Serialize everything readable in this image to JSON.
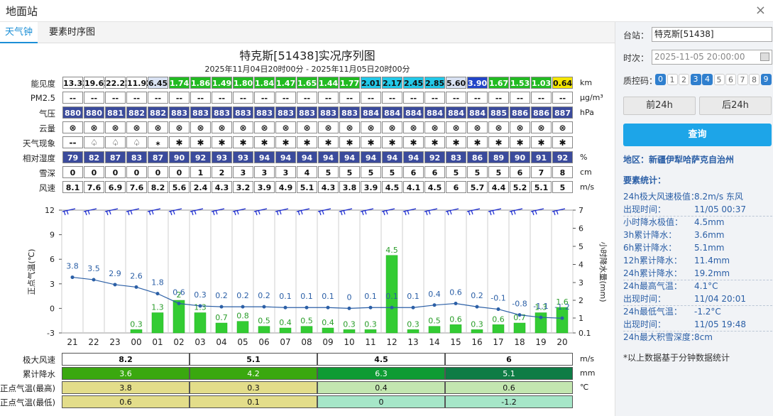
{
  "window": {
    "title": "地面站",
    "close": "×"
  },
  "tabs": [
    "天气钟",
    "要素时序图"
  ],
  "chart_title": "特克斯[51438]实况序列图",
  "chart_subtitle": "2025年11月04日20时00分 - 2025年11月05日20时00分",
  "hours": [
    "21",
    "22",
    "23",
    "00",
    "01",
    "02",
    "03",
    "04",
    "05",
    "06",
    "07",
    "08",
    "09",
    "10",
    "11",
    "12",
    "13",
    "14",
    "15",
    "16",
    "17",
    "18",
    "19",
    "20"
  ],
  "grid_rows": [
    {
      "label": "能见度",
      "unit": "km",
      "values": [
        "13.33",
        "19.61",
        "22.23",
        "11.92",
        "6.45",
        "1.74",
        "1.86",
        "1.49",
        "1.80",
        "1.84",
        "1.47",
        "1.65",
        "1.44",
        "1.77",
        "2.01",
        "2.17",
        "2.45",
        "2.85",
        "5.60",
        "3.90",
        "1.67",
        "1.53",
        "1.03",
        "0.64"
      ],
      "colors": [
        "#ffffff",
        "#ffffff",
        "#ffffff",
        "#ffffff",
        "#d9e2f3",
        "#22bb22",
        "#22bb22",
        "#22bb22",
        "#22bb22",
        "#22bb22",
        "#22bb22",
        "#22bb22",
        "#22bb22",
        "#22bb22",
        "#22c8e8",
        "#22c8e8",
        "#22c8e8",
        "#22c8e8",
        "#d9e2f3",
        "#2244c8",
        "#22bb22",
        "#22bb22",
        "#22bb22",
        "#f5e600"
      ]
    },
    {
      "label": "PM2.5",
      "unit": "μg/m³",
      "values": [
        "--",
        "--",
        "--",
        "--",
        "--",
        "--",
        "--",
        "--",
        "--",
        "--",
        "--",
        "--",
        "--",
        "--",
        "--",
        "--",
        "--",
        "--",
        "--",
        "--",
        "--",
        "--",
        "--",
        "--"
      ]
    },
    {
      "label": "气压",
      "unit": "hPa",
      "values": [
        "880",
        "880",
        "881",
        "882",
        "882",
        "883",
        "883",
        "883",
        "883",
        "883",
        "883",
        "883",
        "883",
        "883",
        "884",
        "884",
        "884",
        "884",
        "884",
        "884",
        "885",
        "886",
        "886",
        "887"
      ]
    },
    {
      "label": "云量",
      "unit": "",
      "values": [
        "⊗",
        "⊗",
        "⊗",
        "⊗",
        "⊗",
        "⊗",
        "⊗",
        "⊗",
        "⊗",
        "⊗",
        "⊗",
        "⊗",
        "⊗",
        "⊗",
        "⊗",
        "⊗",
        "⊗",
        "⊗",
        "⊗",
        "⊗",
        "⊗",
        "⊗",
        "⊗",
        "⊗"
      ]
    },
    {
      "label": "天气现象",
      "unit": "",
      "values": [
        "--",
        "♤",
        "♤",
        "♤",
        "⁎",
        "✱",
        "✱",
        "✱",
        "✱",
        "✱",
        "✱",
        "✱",
        "✱",
        "✱",
        "✱",
        "✱",
        "✱",
        "✱",
        "✱",
        "✱",
        "✱",
        "✱",
        "✱",
        "✱"
      ]
    },
    {
      "label": "相对湿度",
      "unit": "%",
      "values": [
        "79",
        "82",
        "87",
        "83",
        "87",
        "90",
        "92",
        "93",
        "93",
        "94",
        "94",
        "94",
        "94",
        "94",
        "94",
        "94",
        "94",
        "92",
        "83",
        "86",
        "89",
        "90",
        "91",
        "92"
      ]
    },
    {
      "label": "雪深",
      "unit": "cm",
      "values": [
        "0",
        "0",
        "0",
        "0",
        "0",
        "0",
        "1",
        "2",
        "3",
        "3",
        "3",
        "4",
        "5",
        "5",
        "5",
        "5",
        "6",
        "6",
        "5",
        "5",
        "5",
        "6",
        "7",
        "8"
      ]
    },
    {
      "label": "风速",
      "unit": "m/s",
      "values": [
        "8.1",
        "7.6",
        "6.9",
        "7.6",
        "8.2",
        "5.6",
        "2.4",
        "4.3",
        "3.2",
        "3.9",
        "4.9",
        "5.1",
        "4.3",
        "3.8",
        "3.9",
        "4.5",
        "4.1",
        "4.5",
        "6",
        "5.7",
        "4.4",
        "5.2",
        "5.1",
        "5"
      ]
    }
  ],
  "chart_data": {
    "type": "bar",
    "categories": [
      "21",
      "22",
      "23",
      "00",
      "01",
      "02",
      "03",
      "04",
      "05",
      "06",
      "07",
      "08",
      "09",
      "10",
      "11",
      "12",
      "13",
      "14",
      "15",
      "16",
      "17",
      "18",
      "19",
      "20"
    ],
    "series": [
      {
        "values": [
          3.8,
          3.5,
          2.9,
          2.6,
          1.8,
          0.6,
          0.3,
          0.2,
          0.2,
          0.2,
          0.1,
          0.1,
          0.1,
          0,
          0.1,
          0.1,
          0.1,
          0.4,
          0.6,
          0.2,
          -0.1,
          -0.8,
          -1.1,
          -1.2
        ],
        "color": "#2b5fa6"
      },
      {
        "values": [
          0,
          0,
          0,
          0.3,
          1.3,
          2,
          1.3,
          0.7,
          0.8,
          0.5,
          0.4,
          0.5,
          0.4,
          0.3,
          0.3,
          4.5,
          0.3,
          0.5,
          0.6,
          0.3,
          0.6,
          0.7,
          1.3,
          1.6
        ],
        "color": "#33cc33"
      }
    ],
    "ylabel": "正点气温(℃)",
    "y2label": "小时降水量(mm)",
    "ylim": [
      -3,
      12
    ],
    "y2lim": [
      0,
      7
    ],
    "yticks": [
      "12",
      "9",
      "6",
      "3",
      "0",
      "-3"
    ],
    "y2ticks": [
      "7",
      "6",
      "5",
      "4",
      "3",
      "2",
      "1",
      "0.1"
    ],
    "grid": true
  },
  "bottom": {
    "rows": [
      {
        "label": "极大风速",
        "unit": "m/s",
        "values": [
          "8.2",
          "5.1",
          "4.5",
          "6"
        ],
        "colors": [
          "#ffffff",
          "#ffffff",
          "#ffffff",
          "#ffffff"
        ]
      },
      {
        "label": "累计降水",
        "unit": "mm",
        "values": [
          "3.6",
          "4.2",
          "6.3",
          "5.1"
        ],
        "colors": [
          "#3aa80f",
          "#3aa80f",
          "#0e9b33",
          "#0e7c45"
        ]
      },
      {
        "label": "正点气温(最高)",
        "unit": "℃",
        "values": [
          "3.8",
          "0.3",
          "0.4",
          "0.6"
        ],
        "colors": [
          "#e3dd8a",
          "#e3dd8a",
          "#c3e6b0",
          "#c3e6b0"
        ]
      },
      {
        "label": "正点气温(最低)",
        "unit": "",
        "values": [
          "0.6",
          "0.1",
          "0",
          "-1.2"
        ],
        "colors": [
          "#e3dd8a",
          "#e3dd8a",
          "#a6e6c8",
          "#a6e6c8"
        ]
      }
    ]
  },
  "side": {
    "station_label": "台站：",
    "station_value": "特克斯[51438]",
    "time_label": "时次：",
    "time_value": "2025-11-05 20:00:00",
    "qc_label": "质控码：",
    "qc": [
      {
        "n": "0",
        "on": true
      },
      {
        "n": "1",
        "on": false
      },
      {
        "n": "2",
        "on": false
      },
      {
        "n": "3",
        "on": true
      },
      {
        "n": "4",
        "on": true
      },
      {
        "n": "5",
        "on": false
      },
      {
        "n": "6",
        "on": false
      },
      {
        "n": "7",
        "on": false
      },
      {
        "n": "8",
        "on": false
      },
      {
        "n": "9",
        "on": true
      }
    ],
    "prev": "前24h",
    "next": "后24h",
    "query": "查询",
    "region": "地区：新疆伊犁哈萨克自治州",
    "stats_title": "要素统计：",
    "stats": [
      {
        "k": "24h极大风速极值：",
        "v": "8.2m/s 东风"
      },
      {
        "k": "出现时间：",
        "v": "11/05 00:37"
      },
      {
        "k": "小时降水极值：",
        "v": "4.5mm"
      },
      {
        "k": "3h累计降水：",
        "v": "3.6mm"
      },
      {
        "k": "6h累计降水：",
        "v": "5.1mm"
      },
      {
        "k": "12h累计降水：",
        "v": "11.4mm"
      },
      {
        "k": "24h累计降水：",
        "v": "19.2mm"
      },
      {
        "k": "24h最高气温：",
        "v": "4.1°C"
      },
      {
        "k": "出现时间：",
        "v": "11/04 20:01"
      },
      {
        "k": "24h最低气温：",
        "v": "-1.2°C"
      },
      {
        "k": "出现时间：",
        "v": "11/05 19:48"
      },
      {
        "k": "24h最大积雪深度：",
        "v": "8cm"
      }
    ],
    "note": "*以上数据基于分钟数据统计"
  }
}
